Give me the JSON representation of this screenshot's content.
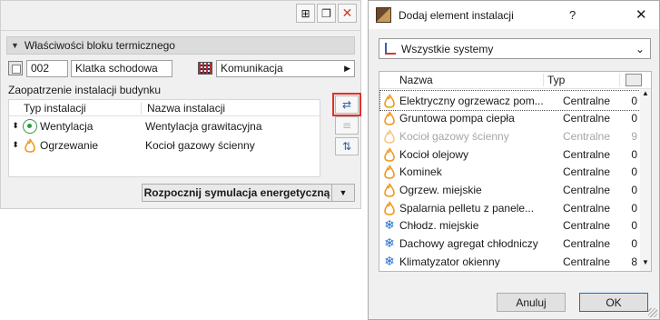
{
  "left_panel": {
    "section_title": "Właściwości bloku termicznego",
    "block_id": "002",
    "block_name": "Klatka schodowa",
    "category": "Komunikacja",
    "supply_label": "Zaopatrzenie instalacji budynku",
    "table_headers": {
      "type": "Typ instalacji",
      "name": "Nazwa instalacji"
    },
    "rows": [
      {
        "type": "Wentylacja",
        "name": "Wentylacja grawitacyjna",
        "icon": "ventilation-icon"
      },
      {
        "type": "Ogrzewanie",
        "name": "Kocioł gazowy ścienny",
        "icon": "flame-icon"
      }
    ],
    "simulate_button": "Rozpocznij symulacja energetyczną"
  },
  "dialog": {
    "title": "Dodaj element instalacji",
    "help": "?",
    "close": "✕",
    "filter": "Wszystkie systemy",
    "columns": {
      "name": "Nazwa",
      "type": "Typ"
    },
    "items": [
      {
        "name": "Elektryczny ogrzewacz pom...",
        "type": "Centralne",
        "count": "0",
        "icon": "flame",
        "disabled": false,
        "focused": true
      },
      {
        "name": "Gruntowa pompa ciepła",
        "type": "Centralne",
        "count": "0",
        "icon": "flame",
        "disabled": false
      },
      {
        "name": "Kocioł gazowy ścienny",
        "type": "Centralne",
        "count": "9",
        "icon": "flame",
        "disabled": true
      },
      {
        "name": "Kocioł olejowy",
        "type": "Centralne",
        "count": "0",
        "icon": "flame",
        "disabled": false
      },
      {
        "name": "Kominek",
        "type": "Centralne",
        "count": "0",
        "icon": "flame",
        "disabled": false
      },
      {
        "name": "Ogrzew. miejskie",
        "type": "Centralne",
        "count": "0",
        "icon": "flame",
        "disabled": false
      },
      {
        "name": "Spalarnia pelletu z panele...",
        "type": "Centralne",
        "count": "0",
        "icon": "flame",
        "disabled": false
      },
      {
        "name": "Chłodz. miejskie",
        "type": "Centralne",
        "count": "0",
        "icon": "snowflake",
        "disabled": false
      },
      {
        "name": "Dachowy agregat chłodniczy",
        "type": "Centralne",
        "count": "0",
        "icon": "snowflake",
        "disabled": false
      },
      {
        "name": "Klimatyzator okienny",
        "type": "Centralne",
        "count": "8",
        "icon": "snowflake",
        "disabled": false
      }
    ],
    "cancel_button": "Anuluj",
    "ok_button": "OK"
  },
  "colors": {
    "flame_orange": "#f29a1e",
    "snow_blue": "#1f6fd6",
    "highlight_red": "#e0302a",
    "vent_green": "#2e9a43"
  }
}
